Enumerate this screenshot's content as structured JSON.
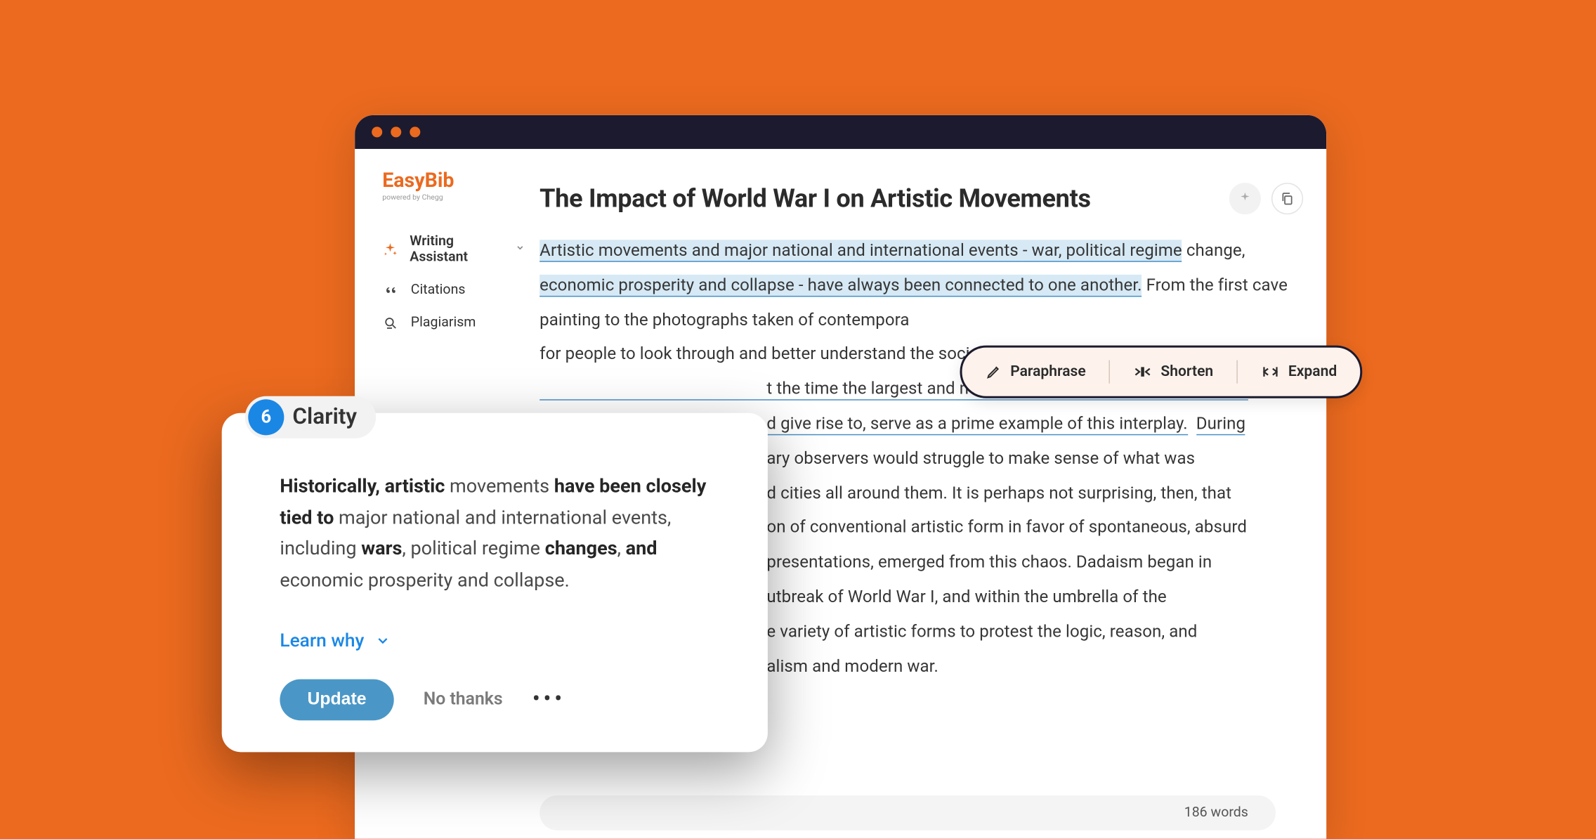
{
  "brand": {
    "name": "EasyBib",
    "tagline": "powered by Chegg"
  },
  "sidebar": {
    "items": [
      {
        "label": "Writing Assistant"
      },
      {
        "label": "Citations"
      },
      {
        "label": "Plagiarism"
      }
    ]
  },
  "document": {
    "title": "The Impact of World War I on Artistic Movements",
    "highlight1": "Artistic movements and major national and international events - war, political regime",
    "highlight1b": " change, ",
    "highlight2": "economic prosperity and collapse - have always been connected to one another.",
    "plain1": " From the first cave painting to the photographs taken of contempora",
    "plain1b": " for people to look through and better understand the social u",
    "ul1": "t the time the largest and most costly war in human history) and",
    "ul2": "d give rise to, serve as a prime example of this interplay.",
    "ul3": "During",
    "plain2": "ary observers would struggle to make sense of what was ",
    "plain3": "d cities all around them. It is perhaps not surprising, then, that ",
    "plain4": "on of conventional artistic form in favor of spontaneous, absurd ",
    "plain5": "presentations, emerged from this chaos.  Dadaism began in ",
    "plain6": "utbreak of World War I, and within the umbrella of the ",
    "plain7": "e variety of artistic forms to protest the logic, reason, and ",
    "plain8": "alism and modern war.",
    "word_count": "186 words"
  },
  "suggestion": {
    "count": "6",
    "type": "Clarity",
    "text_parts": {
      "b1": "Historically, artistic",
      "p1": " movements ",
      "b2": "have been closely tied to",
      "p2": " major national and international events, including ",
      "b3": "wars",
      "p3": ", political regime ",
      "b4": "changes",
      "p4": ", ",
      "b5": "and",
      "p5": " economic prosperity and collapse."
    },
    "learn_why": "Learn why",
    "update": "Update",
    "no_thanks": "No thanks"
  },
  "toolbar": {
    "paraphrase": "Paraphrase",
    "shorten": "Shorten",
    "expand": "Expand"
  }
}
